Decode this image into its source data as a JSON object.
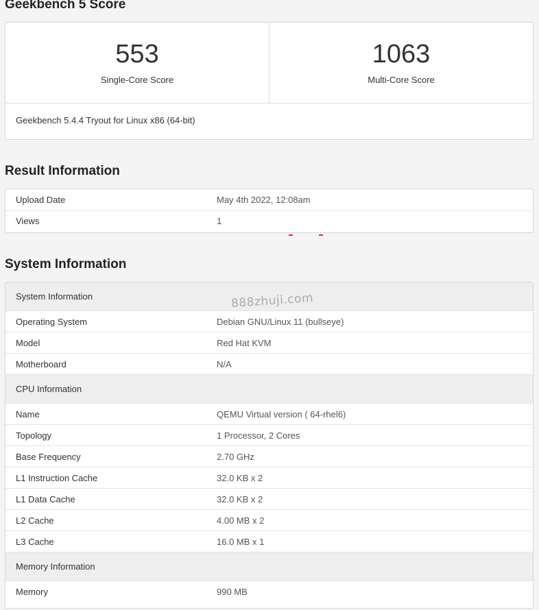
{
  "score_section": {
    "title": "Geekbench 5 Score",
    "single_core": {
      "value": "553",
      "label": "Single-Core Score"
    },
    "multi_core": {
      "value": "1063",
      "label": "Multi-Core Score"
    },
    "version": "Geekbench 5.4.4 Tryout for Linux x86 (64-bit)"
  },
  "result_section": {
    "title": "Result Information",
    "rows": [
      {
        "name": "Upload Date",
        "value": "May 4th 2022, 12:08am"
      },
      {
        "name": "Views",
        "value": "1"
      }
    ]
  },
  "system_section": {
    "title": "System Information",
    "groups": [
      {
        "header": "System Information",
        "rows": [
          {
            "name": "Operating System",
            "value": "Debian GNU/Linux 11 (bullseye)"
          },
          {
            "name": "Model",
            "value": "Red Hat KVM"
          },
          {
            "name": "Motherboard",
            "value": "N/A"
          }
        ]
      },
      {
        "header": "CPU Information",
        "rows": [
          {
            "name": "Name",
            "value": "QEMU Virtual version ( 64-rhel6)"
          },
          {
            "name": "Topology",
            "value": "1 Processor, 2 Cores"
          },
          {
            "name": "Base Frequency",
            "value": "2.70 GHz"
          },
          {
            "name": "L1 Instruction Cache",
            "value": "32.0 KB x 2"
          },
          {
            "name": "L1 Data Cache",
            "value": "32.0 KB x 2"
          },
          {
            "name": "L2 Cache",
            "value": "4.00 MB x 2"
          },
          {
            "name": "L3 Cache",
            "value": "16.0 MB x 1"
          }
        ]
      },
      {
        "header": "Memory Information",
        "rows": [
          {
            "name": "Memory",
            "value": "990 MB"
          }
        ]
      }
    ]
  },
  "watermark": "888zhuji.com",
  "colors": {
    "background": "#f4f4f4",
    "panel": "#ffffff",
    "section_header": "#eeeeee",
    "red_mark": "#ee2233"
  }
}
